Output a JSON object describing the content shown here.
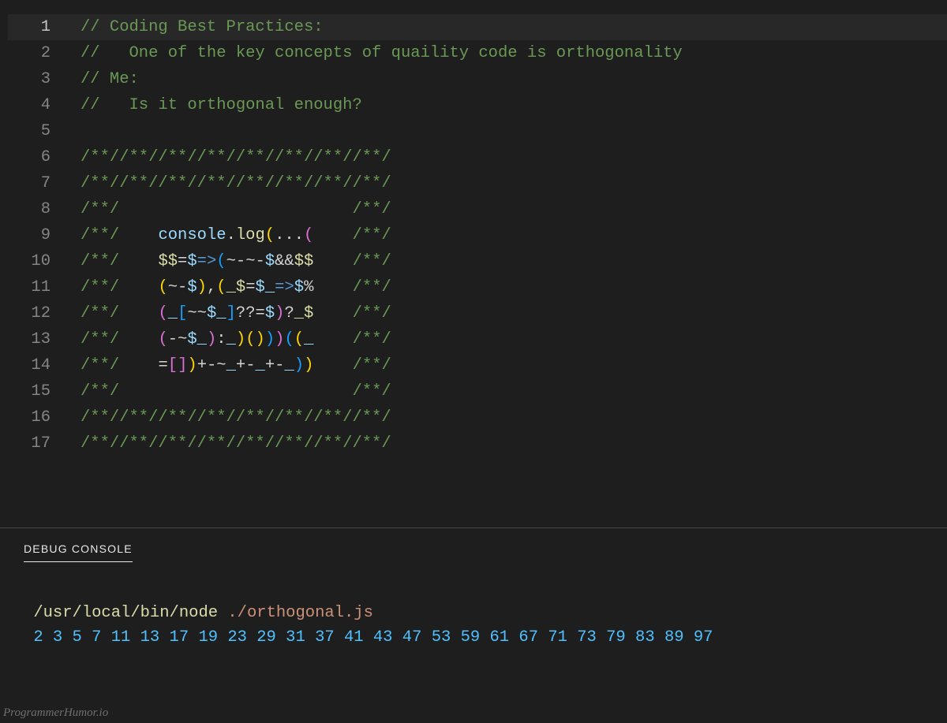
{
  "editor": {
    "lines": [
      {
        "n": "1",
        "current": true,
        "tokens": [
          {
            "c": "tok-comment",
            "t": "// Coding Best Practices:"
          }
        ]
      },
      {
        "n": "2",
        "current": false,
        "tokens": [
          {
            "c": "tok-comment",
            "t": "//   One of the key concepts of quaility code is orthogonality"
          }
        ]
      },
      {
        "n": "3",
        "current": false,
        "tokens": [
          {
            "c": "tok-comment",
            "t": "// Me:"
          }
        ]
      },
      {
        "n": "4",
        "current": false,
        "tokens": [
          {
            "c": "tok-comment",
            "t": "//   Is it orthogonal enough?"
          }
        ]
      },
      {
        "n": "5",
        "current": false,
        "tokens": []
      },
      {
        "n": "6",
        "current": false,
        "tokens": [
          {
            "c": "tok-comment",
            "t": "/**//**//**//**//**//**//**//**/"
          }
        ]
      },
      {
        "n": "7",
        "current": false,
        "tokens": [
          {
            "c": "tok-comment",
            "t": "/**//**//**//**//**//**//**//**/"
          }
        ]
      },
      {
        "n": "8",
        "current": false,
        "tokens": [
          {
            "c": "tok-comment",
            "t": "/**/"
          },
          {
            "c": "tok-op",
            "t": "                        "
          },
          {
            "c": "tok-comment",
            "t": "/**/"
          }
        ]
      },
      {
        "n": "9",
        "current": false,
        "tokens": [
          {
            "c": "tok-comment",
            "t": "/**/"
          },
          {
            "c": "tok-op",
            "t": "    "
          },
          {
            "c": "tok-ident",
            "t": "console"
          },
          {
            "c": "tok-op",
            "t": "."
          },
          {
            "c": "tok-prop",
            "t": "log"
          },
          {
            "c": "tok-gold",
            "t": "("
          },
          {
            "c": "tok-op",
            "t": "..."
          },
          {
            "c": "tok-pink",
            "t": "("
          },
          {
            "c": "tok-op",
            "t": "    "
          },
          {
            "c": "tok-comment",
            "t": "/**/"
          }
        ]
      },
      {
        "n": "10",
        "current": false,
        "tokens": [
          {
            "c": "tok-comment",
            "t": "/**/"
          },
          {
            "c": "tok-op",
            "t": "    "
          },
          {
            "c": "tok-prop",
            "t": "$$"
          },
          {
            "c": "tok-op",
            "t": "="
          },
          {
            "c": "tok-var",
            "t": "$"
          },
          {
            "c": "tok-keyword",
            "t": "=>"
          },
          {
            "c": "tok-blue",
            "t": "("
          },
          {
            "c": "tok-op",
            "t": "~-~-"
          },
          {
            "c": "tok-var",
            "t": "$"
          },
          {
            "c": "tok-op",
            "t": "&&"
          },
          {
            "c": "tok-prop",
            "t": "$$"
          },
          {
            "c": "tok-op",
            "t": "    "
          },
          {
            "c": "tok-comment",
            "t": "/**/"
          }
        ]
      },
      {
        "n": "11",
        "current": false,
        "tokens": [
          {
            "c": "tok-comment",
            "t": "/**/"
          },
          {
            "c": "tok-op",
            "t": "    "
          },
          {
            "c": "tok-gold",
            "t": "("
          },
          {
            "c": "tok-op",
            "t": "~-"
          },
          {
            "c": "tok-var",
            "t": "$"
          },
          {
            "c": "tok-gold",
            "t": ")"
          },
          {
            "c": "tok-op",
            "t": ","
          },
          {
            "c": "tok-gold",
            "t": "("
          },
          {
            "c": "tok-prop",
            "t": "_$"
          },
          {
            "c": "tok-op",
            "t": "="
          },
          {
            "c": "tok-var",
            "t": "$_"
          },
          {
            "c": "tok-keyword",
            "t": "=>"
          },
          {
            "c": "tok-var",
            "t": "$"
          },
          {
            "c": "tok-op",
            "t": "%"
          },
          {
            "c": "tok-op",
            "t": "    "
          },
          {
            "c": "tok-comment",
            "t": "/**/"
          }
        ]
      },
      {
        "n": "12",
        "current": false,
        "tokens": [
          {
            "c": "tok-comment",
            "t": "/**/"
          },
          {
            "c": "tok-op",
            "t": "    "
          },
          {
            "c": "tok-pink",
            "t": "("
          },
          {
            "c": "tok-var",
            "t": "_"
          },
          {
            "c": "tok-blue",
            "t": "["
          },
          {
            "c": "tok-op",
            "t": "~~"
          },
          {
            "c": "tok-var",
            "t": "$_"
          },
          {
            "c": "tok-blue",
            "t": "]"
          },
          {
            "c": "tok-op",
            "t": "??="
          },
          {
            "c": "tok-var",
            "t": "$"
          },
          {
            "c": "tok-pink",
            "t": ")"
          },
          {
            "c": "tok-op",
            "t": "?"
          },
          {
            "c": "tok-prop",
            "t": "_$"
          },
          {
            "c": "tok-op",
            "t": "    "
          },
          {
            "c": "tok-comment",
            "t": "/**/"
          }
        ]
      },
      {
        "n": "13",
        "current": false,
        "tokens": [
          {
            "c": "tok-comment",
            "t": "/**/"
          },
          {
            "c": "tok-op",
            "t": "    "
          },
          {
            "c": "tok-pink",
            "t": "("
          },
          {
            "c": "tok-op",
            "t": "-~"
          },
          {
            "c": "tok-var",
            "t": "$_"
          },
          {
            "c": "tok-pink",
            "t": ")"
          },
          {
            "c": "tok-op",
            "t": ":"
          },
          {
            "c": "tok-var",
            "t": "_"
          },
          {
            "c": "tok-gold",
            "t": ")"
          },
          {
            "c": "tok-gold",
            "t": "("
          },
          {
            "c": "tok-gold",
            "t": ")"
          },
          {
            "c": "tok-blue",
            "t": ")"
          },
          {
            "c": "tok-pink",
            "t": ")"
          },
          {
            "c": "tok-blue",
            "t": "("
          },
          {
            "c": "tok-gold",
            "t": "("
          },
          {
            "c": "tok-var",
            "t": "_"
          },
          {
            "c": "tok-op",
            "t": "    "
          },
          {
            "c": "tok-comment",
            "t": "/**/"
          }
        ]
      },
      {
        "n": "14",
        "current": false,
        "tokens": [
          {
            "c": "tok-comment",
            "t": "/**/"
          },
          {
            "c": "tok-op",
            "t": "    "
          },
          {
            "c": "tok-op",
            "t": "="
          },
          {
            "c": "tok-pink",
            "t": "["
          },
          {
            "c": "tok-pink",
            "t": "]"
          },
          {
            "c": "tok-gold",
            "t": ")"
          },
          {
            "c": "tok-op",
            "t": "+-~"
          },
          {
            "c": "tok-var",
            "t": "_"
          },
          {
            "c": "tok-op",
            "t": "+-"
          },
          {
            "c": "tok-var",
            "t": "_"
          },
          {
            "c": "tok-op",
            "t": "+-"
          },
          {
            "c": "tok-var",
            "t": "_"
          },
          {
            "c": "tok-blue",
            "t": ")"
          },
          {
            "c": "tok-gold",
            "t": ")"
          },
          {
            "c": "tok-op",
            "t": "    "
          },
          {
            "c": "tok-comment",
            "t": "/**/"
          }
        ]
      },
      {
        "n": "15",
        "current": false,
        "tokens": [
          {
            "c": "tok-comment",
            "t": "/**/"
          },
          {
            "c": "tok-op",
            "t": "                        "
          },
          {
            "c": "tok-comment",
            "t": "/**/"
          }
        ]
      },
      {
        "n": "16",
        "current": false,
        "tokens": [
          {
            "c": "tok-comment",
            "t": "/**//**//**//**//**//**//**//**/"
          }
        ]
      },
      {
        "n": "17",
        "current": false,
        "tokens": [
          {
            "c": "tok-comment",
            "t": "/**//**//**//**//**//**//**//**/"
          }
        ]
      }
    ]
  },
  "debug": {
    "tab_label": "DEBUG CONSOLE",
    "cmd_path": "/usr/local/bin/node ",
    "cmd_arg": "./orthogonal.js",
    "output": "2 3 5 7 11 13 17 19 23 29 31 37 41 43 47 53 59 61 67 71 73 79 83 89 97"
  },
  "watermark": "ProgrammerHumor.io"
}
